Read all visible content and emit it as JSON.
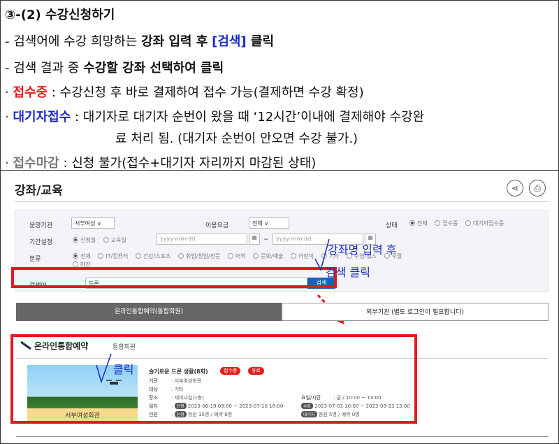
{
  "instruction": {
    "heading": "③-(2) 수강신청하기",
    "line2": {
      "pre": "- 검색어에 수강 희망하는 ",
      "bold": "강좌 입력 후",
      "mid": " ",
      "highlight": "[검색]",
      "post": " 클릭"
    },
    "line3": {
      "pre": "- 검색 결과 중 ",
      "bold": "수강할 강좌 선택하여 클릭"
    },
    "bullet": "·",
    "status1": {
      "label": "접수중",
      "desc": " : 수강신청 후 바로 결제하여 접수 가능(결제하면 수강 확정)"
    },
    "status2": {
      "label": "대기자접수",
      "desc": " :  대기자로 대기자 순번이 왔을 때 ‘12시간’이내에 결제해야 수강완",
      "cont": "료 처리 됨. (대기자 순번이 안오면 수강 불가.)"
    },
    "status3": {
      "label": "접수마감",
      "desc": " : 신청 불가(접수+대기자 자리까지 마감된 상태)"
    }
  },
  "page": {
    "title": "강좌/교육",
    "share_icon": "share-icon",
    "print_icon": "print-icon",
    "share_glyph": "⋖",
    "print_glyph": "⎙"
  },
  "filter": {
    "org_label": "운영기관",
    "org_value": "서부여성 ∨",
    "fee_label": "이용요금",
    "fee_value": "전체 ∨",
    "status_label": "상태",
    "status_options": [
      "전체",
      "접수중",
      "대기자접수중"
    ],
    "period_label": "기간설정",
    "period_options": [
      "신청일",
      "교육일"
    ],
    "date_placeholder_from": "yyyy-mm-dd",
    "date_sep": "~",
    "date_placeholder_to": "yyyy-mm-dd",
    "calendar_glyph": "▦",
    "category_label": "분류",
    "category_options_row1": [
      "전체",
      "IT/컴퓨터",
      "건강/스포츠",
      "취업/창업/전문",
      "어학",
      "문화/예술",
      "어린이",
      "기타",
      "수영/헬스",
      "주말"
    ],
    "category_options_row2": [
      "야간"
    ],
    "keyword_label": "검색어",
    "keyword_value": "드론",
    "search_button": "검색"
  },
  "annotations": {
    "enter_course": "강좌명 입력 후",
    "click_search": "검색 클릭",
    "click": "클릭"
  },
  "tabs": {
    "online": "온라인통합예약(통합회원)",
    "external": "외부기관 (별도 로그인이 필요합니다)"
  },
  "results": {
    "section_title": "온라인통합예약",
    "section_sub": "통합회원",
    "course": {
      "title": "슬기로운 드론 생활(8회)",
      "badge_status": "접수중",
      "badge_fee": "유료",
      "rows": [
        {
          "k": "기관",
          "v": ": 서부여성회관"
        },
        {
          "k": "대상",
          "v": ": 기타"
        },
        {
          "k": "장소",
          "v": ": 세미나실(1층)"
        },
        {
          "k": "일자",
          "pill": "신청",
          "v": " 2023-06-19 09:00 ~ 2023-07-10 18:00"
        },
        {
          "k": "인원",
          "pill": "신청",
          "v": " 정원 15명 / 예약 6명"
        }
      ],
      "right_rows": [
        {
          "k": "요일/시간",
          "v": ": 금 / 10:00 ~ 13:00"
        },
        {
          "pill": "수강",
          "v": " 2023-07-03 10:00 ~ 2023-09-23 13:00"
        },
        {
          "pill": "대기자",
          "v": " 정원 5명 / 예약 0명"
        }
      ],
      "thumb_caption": "서부여성회관"
    }
  }
}
